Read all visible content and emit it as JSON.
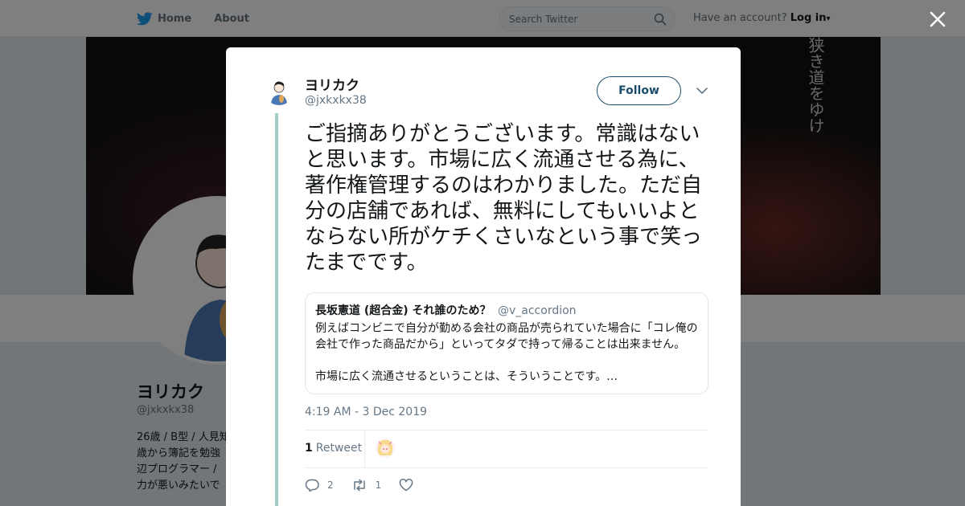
{
  "topbar": {
    "home_label": "Home",
    "about_label": "About",
    "search_placeholder": "Search Twitter",
    "account_prompt": "Have an account?",
    "login_label": "Log in",
    "login_caret": "▾"
  },
  "banner": {
    "vertical_text": "狭き道をゆけ"
  },
  "background_profile": {
    "name": "ヨリカク",
    "handle": "@jxkxkx38",
    "bio_lines": [
      "26歳 / B型 / 人見知",
      "歳から簿記を勉強",
      "辺プログラマー /",
      "力が悪いみたいで"
    ]
  },
  "tweet": {
    "author_name": "ヨリカク",
    "author_handle": "@jxkxkx38",
    "follow_label": "Follow",
    "text": "ご指摘ありがとうございます。常識はないと思います。市場に広く流通させる為に、著作権管理するのはわかりました。ただ自分の店舗であれば、無料にしてもいいよとならない所がケチくさいなという事で笑ったまでです。",
    "quote": {
      "name": "長坂憲道 (超合金) それ誰のため？",
      "handle": "@v_accordion",
      "text": "例えばコンビニで自分が勤める会社の商品が売られていた場合に「コレ俺の会社で作った商品だから」といってタダで持って帰ることは出来ません。\n\n市場に広く流通させるということは、そういうことです。…"
    },
    "timestamp": "4:19 AM - 3 Dec 2019",
    "retweet_count": "1",
    "retweet_label": "Retweet",
    "reply_count": "2",
    "retweet_action_count": "1",
    "like_count": ""
  },
  "colors": {
    "accent": "#1da1f2",
    "follow_border": "#1b4d6b",
    "thread_line": "#a2ccc6",
    "muted_text": "#657786"
  },
  "icons": [
    "twitter-bird-icon",
    "search-icon",
    "close-icon",
    "chevron-down-icon",
    "reply-icon",
    "retweet-icon",
    "heart-icon"
  ]
}
